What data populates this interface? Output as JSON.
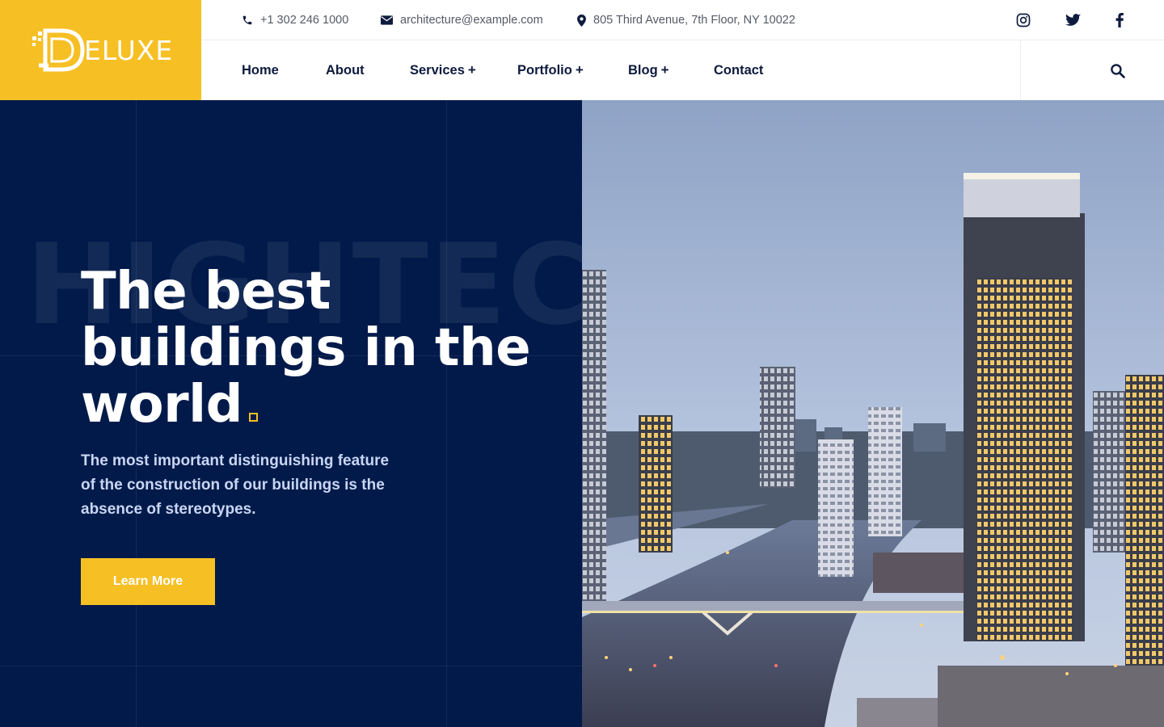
{
  "brand": {
    "name": "ELUXE",
    "logo_icon": "d-logo-mark",
    "accent": "#f6bf24",
    "navy": "#021a4a"
  },
  "topbar": {
    "phone": "+1 302 246 1000",
    "email": "architecture@example.com",
    "address": "805 Third Avenue, 7th Floor, NY 10022",
    "social": [
      {
        "name": "instagram-icon"
      },
      {
        "name": "twitter-icon"
      },
      {
        "name": "facebook-icon"
      }
    ]
  },
  "nav": {
    "items": [
      {
        "label": "Home",
        "has_submenu": false
      },
      {
        "label": "About",
        "has_submenu": false
      },
      {
        "label": "Services",
        "has_submenu": true
      },
      {
        "label": "Portfolio",
        "has_submenu": true
      },
      {
        "label": "Blog",
        "has_submenu": true
      },
      {
        "label": "Contact",
        "has_submenu": false
      }
    ],
    "submenu_marker": "+",
    "search_icon": "search-icon"
  },
  "hero": {
    "background_word": "HIGHTECH",
    "title": "The best buildings in the world",
    "subtitle": "The most important distinguishing feature of the construction of our buildings is the absence of stereotypes.",
    "cta_label": "Learn More",
    "image_alt": "city-skyline-at-dusk"
  }
}
